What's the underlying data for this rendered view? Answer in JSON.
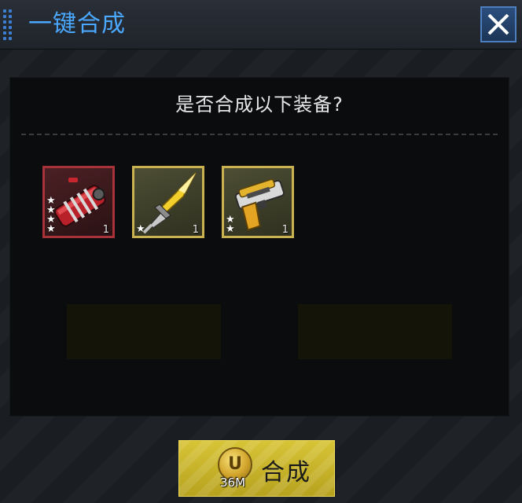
{
  "header": {
    "title": "一键合成",
    "close_icon": "close-icon"
  },
  "dialog": {
    "question": "是否合成以下装备?"
  },
  "items": [
    {
      "name": "red-cannon",
      "rarity_color": "#a8323a",
      "stars": 4,
      "count": "1"
    },
    {
      "name": "golden-blade",
      "rarity_color": "#c9b24f",
      "stars": 1,
      "count": "1"
    },
    {
      "name": "gold-pistol",
      "rarity_color": "#c9b24f",
      "stars": 2,
      "count": "1"
    }
  ],
  "synthesize_button": {
    "label": "合成",
    "cost": "36M",
    "coin_icon": "u-coin-icon",
    "color": "#d8c437"
  },
  "colors": {
    "accent": "#4aa8ff",
    "panel": "#0b0c0e"
  }
}
